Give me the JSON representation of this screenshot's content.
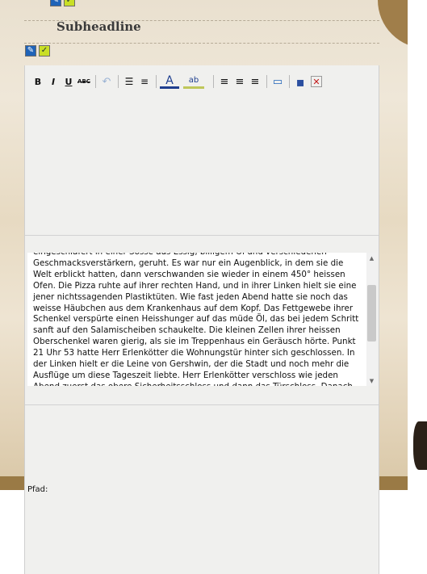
{
  "heading": {
    "text": "Subheadline"
  },
  "heading_icons": [
    "edit-icon",
    "confirm-icon"
  ],
  "colors": {
    "accent_blue": "#1f63b8",
    "confirm_green": "#c9df26",
    "parchment": "#e9e0cf",
    "band": "#9a7a45"
  },
  "toolbar": {
    "bold": "B",
    "italic": "I",
    "underline": "U",
    "strike": "ABC",
    "undo": "↶",
    "bullets": "☰",
    "numbered": "≡",
    "font_color": "A",
    "highlight": "ab",
    "align_left": "≡",
    "align_center": "≡",
    "align_right": "≡",
    "source": "▭",
    "save": "▪",
    "cancel": "✕"
  },
  "editor": {
    "content": "eingeschläfert in einer Sosse aus Essig, billigem Öl und verschiedenen Geschmacksverstärkern, geruht. Es war nur ein Augenblick, in dem sie die Welt erblickt hatten, dann verschwanden sie wieder in einem 450° heissen Ofen. Die Pizza ruhte auf ihrer rechten Hand, und in ihrer Linken hielt sie eine jener nichtssagenden Plastiktüten. Wie fast jeden Abend hatte sie noch das weisse Häubchen aus dem Krankenhaus auf dem Kopf. Das Fettgewebe ihrer Schenkel verspürte einen Heisshunger auf das müde Öl, das bei jedem Schritt sanft auf den Salamischeiben schaukelte. Die kleinen Zellen ihrer heissen Oberschenkel waren gierig, als sie im Treppenhaus ein Geräusch hörte. Punkt 21 Uhr 53 hatte Herr Erlenkötter die Wohnungstür hinter sich geschlossen. In der Linken hielt er die Leine von Gershwin, der die Stadt und noch mehr die Ausflüge um diese Tageszeit liebte. Herr Erlenkötter verschloss wie jeden Abend zuerst das obere Sicherheitsschloss und dann das Türschloss. Danach",
    "path_label": "Pfad:"
  },
  "scrollbar": {
    "up": "▲",
    "down": "▼"
  }
}
